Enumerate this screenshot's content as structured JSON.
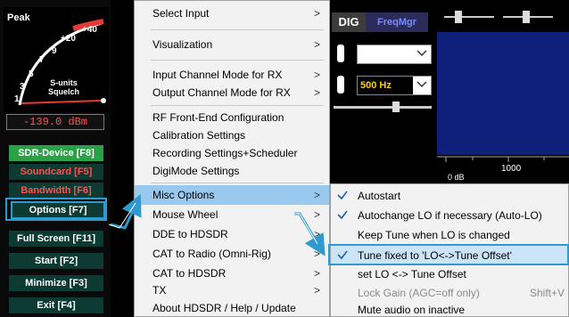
{
  "left_panel": {
    "meter": {
      "peak_label": "Peak",
      "scale_labels": [
        "+40",
        "+20",
        "9",
        "7",
        "5",
        "3",
        "1"
      ],
      "units_label": "S-units",
      "squelch_label": "Squelch"
    },
    "level_readout": "-139.0 dBm",
    "buttons": {
      "sdr_device": "SDR-Device [F8]",
      "soundcard": "Soundcard [F5]",
      "bandwidth": "Bandwidth [F6]",
      "options": "Options   [F7]",
      "full_screen": "Full Screen [F11]",
      "start": "Start     [F2]",
      "minimize": "Minimize [F3]",
      "exit": "Exit     [F4]"
    }
  },
  "toolbar": {
    "dig_label": "DIG",
    "freqmgr_label": "FreqMgr"
  },
  "controls": {
    "select1_value": "",
    "select2_value": "500 Hz"
  },
  "spectrum": {
    "tick_1000": "1000",
    "db_label": "0 dB"
  },
  "main_menu": {
    "items": [
      {
        "label": "Select Input",
        "submenu": true
      },
      {
        "label": "Visualization",
        "submenu": true
      },
      {
        "label": "Input Channel Mode for RX",
        "submenu": true
      },
      {
        "label": "Output Channel Mode for RX",
        "submenu": true
      },
      {
        "label": "RF Front-End Configuration",
        "submenu": false
      },
      {
        "label": "Calibration Settings",
        "submenu": false
      },
      {
        "label": "Recording Settings+Scheduler",
        "submenu": false
      },
      {
        "label": "DigiMode Settings",
        "submenu": false
      },
      {
        "label": "Misc Options",
        "submenu": true,
        "highlighted": true
      },
      {
        "label": "Mouse Wheel",
        "submenu": true
      },
      {
        "label": "DDE to HDSDR",
        "submenu": true
      },
      {
        "label": "CAT to Radio (Omni-Rig)",
        "submenu": true
      },
      {
        "label": "CAT to HDSDR",
        "submenu": true
      },
      {
        "label": "TX",
        "submenu": true
      },
      {
        "label": "About HDSDR / Help / Update",
        "submenu": false
      }
    ],
    "arrow_glyph": ">"
  },
  "sub_menu": {
    "items": [
      {
        "label": "Autostart",
        "checked": true
      },
      {
        "label": "Autochange LO if necessary (Auto-LO)",
        "checked": true
      },
      {
        "label": "Keep Tune when LO is changed",
        "checked": false
      },
      {
        "label": "Tune fixed to 'LO<->Tune Offset'",
        "checked": true,
        "highlighted": true
      },
      {
        "label": "set LO <-> Tune Offset",
        "checked": false
      },
      {
        "label": "Lock Gain (AGC=off only)",
        "checked": false,
        "disabled": true,
        "shortcut": "Shift+V"
      },
      {
        "label": "Mute audio on inactive",
        "checked": false
      }
    ]
  },
  "colors": {
    "accent_blue": "#2e9ad0",
    "menu_highlight": "#99c9ef",
    "button_green": "#0d3b33",
    "button_active": "#2aa146",
    "alert_red": "#ff5252"
  }
}
